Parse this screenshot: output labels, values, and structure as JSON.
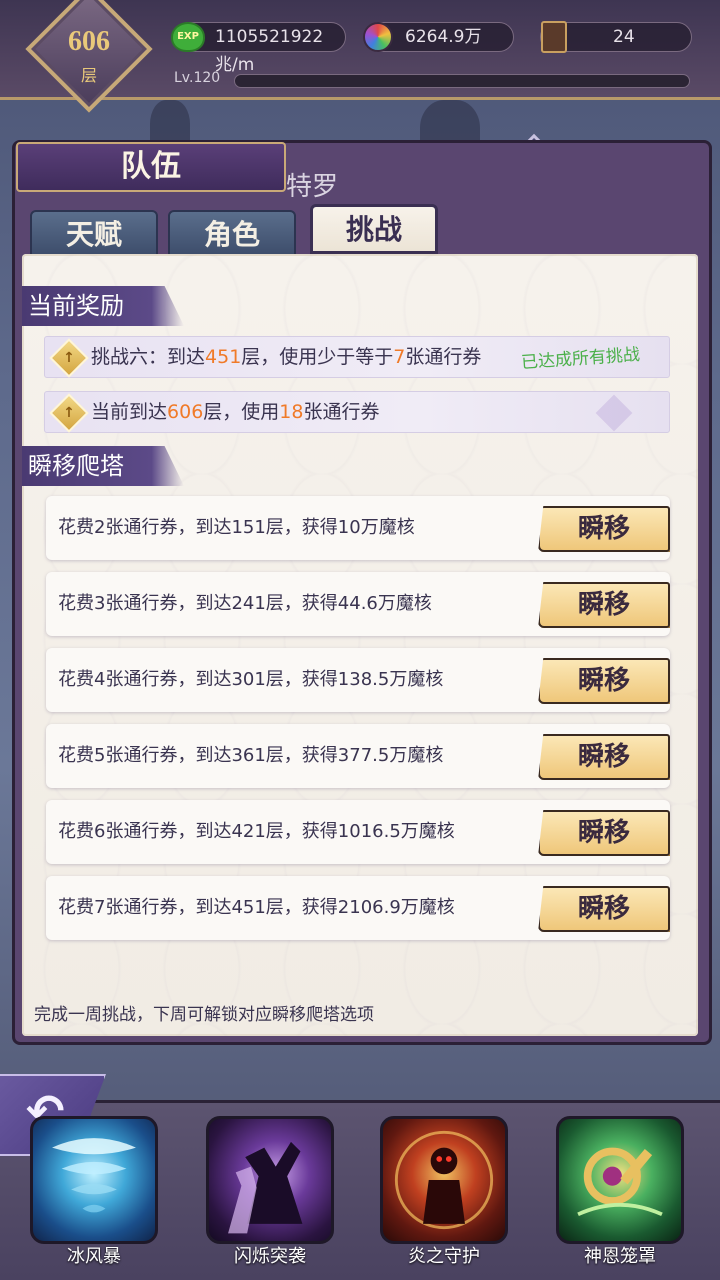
{
  "hud": {
    "floor_number": "606",
    "floor_unit": "层",
    "exp_value": "1105521922兆/m",
    "exp_icon_label": "EXP",
    "magic_core_value": "6264.9万",
    "tickets_value": "24",
    "level_label": "Lv.120",
    "level_progress": 0.0
  },
  "panel": {
    "title": "队伍",
    "ghost_text": "特罗",
    "tabs": [
      {
        "label": "天赋",
        "active": false
      },
      {
        "label": "角色",
        "active": false
      },
      {
        "label": "挑战",
        "active": true
      }
    ]
  },
  "current_reward": {
    "section_title": "当前奖励",
    "challenge_prefix": "挑战六：到达",
    "challenge_floor": "451",
    "challenge_middle": "层，使用少于等于",
    "challenge_tickets": "7",
    "challenge_suffix": "张通行券",
    "challenge_status": "已达成所有挑战",
    "current_prefix": "当前到达",
    "current_floor": "606",
    "current_middle": "层，使用",
    "current_tickets": "18",
    "current_suffix": "张通行券"
  },
  "teleport": {
    "section_title": "瞬移爬塔",
    "button_label": "瞬移",
    "rows": [
      {
        "text": "花费2张通行券，到达151层，获得10万魔核"
      },
      {
        "text": "花费3张通行券，到达241层，获得44.6万魔核"
      },
      {
        "text": "花费4张通行券，到达301层，获得138.5万魔核"
      },
      {
        "text": "花费5张通行券，到达361层，获得377.5万魔核"
      },
      {
        "text": "花费6张通行券，到达421层，获得1016.5万魔核"
      },
      {
        "text": "花费7张通行券，到达451层，获得2106.9万魔核"
      }
    ],
    "footer_note": "完成一周挑战，下周可解锁对应瞬移爬塔选项"
  },
  "skills": [
    {
      "name": "冰风暴",
      "icon": "tornado-icon"
    },
    {
      "name": "闪烁突袭",
      "icon": "shadow-strike-icon"
    },
    {
      "name": "炎之守护",
      "icon": "flame-guardian-icon"
    },
    {
      "name": "神恩笼罩",
      "icon": "holy-key-icon"
    }
  ],
  "colors": {
    "highlight": "#f07a28",
    "done": "#4bb04a",
    "section_bg": "#4a3a72",
    "button_bg": "#efc77a"
  }
}
